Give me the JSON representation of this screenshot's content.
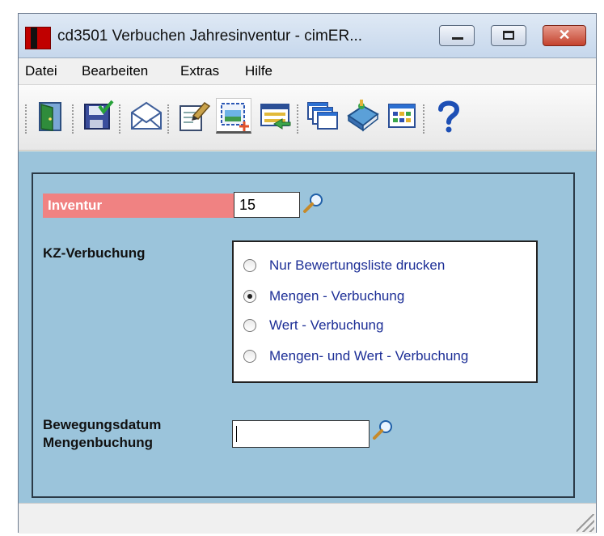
{
  "window": {
    "title": "cd3501 Verbuchen Jahresinventur - cimER...",
    "controls": {
      "minimize": "minimize",
      "maximize": "maximize",
      "close": "✕"
    }
  },
  "menu": {
    "items": [
      "Datei",
      "Bearbeiten",
      "Extras",
      "Hilfe"
    ]
  },
  "toolbar": {
    "buttons": [
      "exit-door-icon",
      "save-icon",
      "mail-envelope-icon",
      "edit-form-icon",
      "new-record-icon",
      "list-import-icon",
      "windows-stack-icon",
      "book-icon",
      "grid-window-icon",
      "help-icon"
    ],
    "active": "new-record-icon"
  },
  "form": {
    "inventur_label": "Inventur",
    "inventur_value": "15",
    "kz_label": "KZ-Verbuchung",
    "options": [
      "Nur Bewertungsliste drucken",
      "Mengen - Verbuchung",
      "Wert - Verbuchung",
      "Mengen- und Wert - Verbuchung"
    ],
    "selected_option": "Mengen - Verbuchung",
    "date_label_line1": "Bewegungsdatum",
    "date_label_line2": "Mengenbuchung",
    "date_value": ""
  },
  "colors": {
    "panel_bg": "#9bc4db",
    "inventur_label_bg": "#f08282",
    "radio_text": "#1c2e96"
  }
}
